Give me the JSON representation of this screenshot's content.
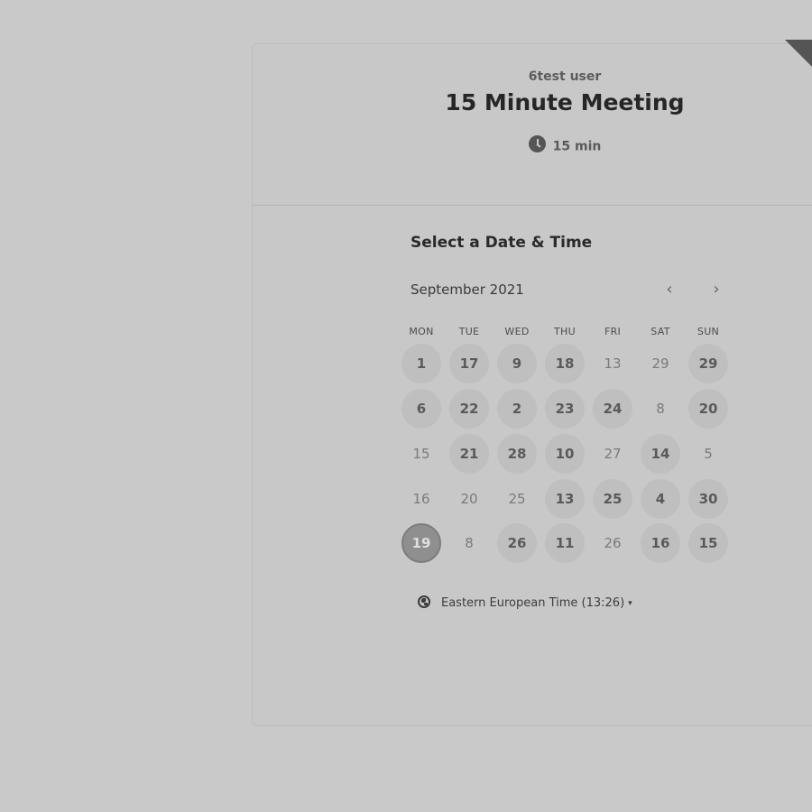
{
  "event": {
    "organizer": "6test user",
    "title": "15 Minute Meeting",
    "duration": "15 min",
    "duration_icon": "clock-icon"
  },
  "calendar": {
    "heading": "Select a Date & Time",
    "month_label": "September 2021",
    "prev_icon": "chevron-left-icon",
    "next_icon": "chevron-right-icon",
    "weekdays": [
      "MON",
      "TUE",
      "WED",
      "THU",
      "FRI",
      "SAT",
      "SUN"
    ],
    "weeks": [
      [
        {
          "label": "1",
          "state": "available"
        },
        {
          "label": "17",
          "state": "available"
        },
        {
          "label": "9",
          "state": "available"
        },
        {
          "label": "18",
          "state": "available"
        },
        {
          "label": "13",
          "state": "unavailable"
        },
        {
          "label": "29",
          "state": "unavailable"
        },
        {
          "label": "29",
          "state": "available"
        }
      ],
      [
        {
          "label": "6",
          "state": "available"
        },
        {
          "label": "22",
          "state": "available"
        },
        {
          "label": "2",
          "state": "available"
        },
        {
          "label": "23",
          "state": "available"
        },
        {
          "label": "24",
          "state": "available"
        },
        {
          "label": "8",
          "state": "unavailable"
        },
        {
          "label": "20",
          "state": "available"
        }
      ],
      [
        {
          "label": "15",
          "state": "unavailable"
        },
        {
          "label": "21",
          "state": "available"
        },
        {
          "label": "28",
          "state": "available"
        },
        {
          "label": "10",
          "state": "available"
        },
        {
          "label": "27",
          "state": "unavailable"
        },
        {
          "label": "14",
          "state": "available"
        },
        {
          "label": "5",
          "state": "unavailable"
        }
      ],
      [
        {
          "label": "16",
          "state": "unavailable"
        },
        {
          "label": "20",
          "state": "unavailable"
        },
        {
          "label": "25",
          "state": "unavailable"
        },
        {
          "label": "13",
          "state": "available"
        },
        {
          "label": "25",
          "state": "available"
        },
        {
          "label": "4",
          "state": "available"
        },
        {
          "label": "30",
          "state": "available"
        }
      ],
      [
        {
          "label": "19",
          "state": "selected"
        },
        {
          "label": "8",
          "state": "unavailable"
        },
        {
          "label": "26",
          "state": "available"
        },
        {
          "label": "11",
          "state": "available"
        },
        {
          "label": "26",
          "state": "unavailable"
        },
        {
          "label": "16",
          "state": "available"
        },
        {
          "label": "15",
          "state": "available"
        }
      ]
    ]
  },
  "timezone": {
    "label": "Eastern European Time (13:26)",
    "icon": "globe-icon",
    "caret": "▾"
  },
  "colors": {
    "background": "#c9c9c9",
    "available_day": "#bfbfbf",
    "selected_day": "#8f8f8f"
  }
}
